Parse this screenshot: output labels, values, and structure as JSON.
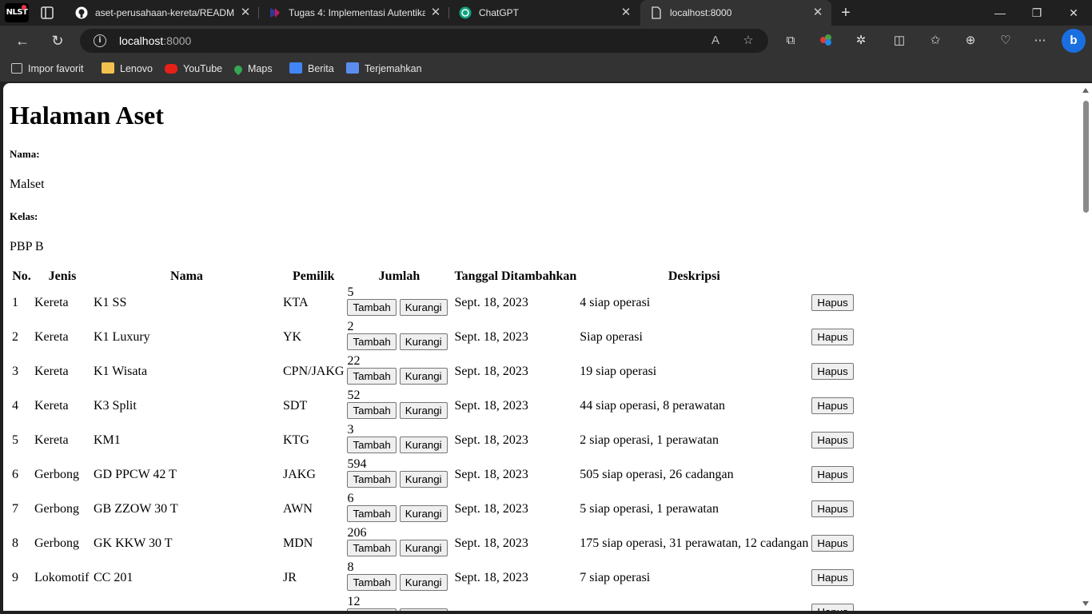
{
  "browser": {
    "profile_label": "NLST",
    "tabs": [
      {
        "title": "aset-perusahaan-kereta/READM",
        "icon": "github-icon"
      },
      {
        "title": "Tugas 4: Implementasi Autentika",
        "icon": "course-site-icon"
      },
      {
        "title": "ChatGPT",
        "icon": "chatgpt-icon"
      },
      {
        "title": "localhost:8000",
        "icon": "page-icon"
      }
    ],
    "address": {
      "host": "localhost",
      "port": ":8000"
    },
    "bookmarks": [
      {
        "label": "Impor favorit",
        "icon": "import-icon"
      },
      {
        "label": "Lenovo",
        "icon": "folder-icon"
      },
      {
        "label": "YouTube",
        "icon": "youtube-icon"
      },
      {
        "label": "Maps",
        "icon": "maps-pin-icon"
      },
      {
        "label": "Berita",
        "icon": "news-icon"
      },
      {
        "label": "Terjemahkan",
        "icon": "translate-icon"
      }
    ],
    "colors": {
      "chrome_bg": "#202020",
      "toolbar_bg": "#333333",
      "accent": "#1a6fe0"
    }
  },
  "page": {
    "title": "Halaman Aset",
    "name_label": "Nama:",
    "name_value": "Malset",
    "class_label": "Kelas:",
    "class_value": "PBP B",
    "table": {
      "headers": [
        "No.",
        "Jenis",
        "Nama",
        "Pemilik",
        "Jumlah",
        "Tanggal Ditambahkan",
        "Deskripsi"
      ],
      "add_label": "Tambah",
      "sub_label": "Kurangi",
      "delete_label": "Hapus",
      "rows": [
        {
          "no": "1",
          "jenis": "Kereta",
          "nama": "K1 SS",
          "pemilik": "KTA",
          "jumlah": "5",
          "tanggal": "Sept. 18, 2023",
          "deskripsi": "4 siap operasi"
        },
        {
          "no": "2",
          "jenis": "Kereta",
          "nama": "K1 Luxury",
          "pemilik": "YK",
          "jumlah": "2",
          "tanggal": "Sept. 18, 2023",
          "deskripsi": "Siap operasi"
        },
        {
          "no": "3",
          "jenis": "Kereta",
          "nama": "K1 Wisata",
          "pemilik": "CPN/JAKG",
          "jumlah": "22",
          "tanggal": "Sept. 18, 2023",
          "deskripsi": "19 siap operasi"
        },
        {
          "no": "4",
          "jenis": "Kereta",
          "nama": "K3 Split",
          "pemilik": "SDT",
          "jumlah": "52",
          "tanggal": "Sept. 18, 2023",
          "deskripsi": "44 siap operasi, 8 perawatan"
        },
        {
          "no": "5",
          "jenis": "Kereta",
          "nama": "KM1",
          "pemilik": "KTG",
          "jumlah": "3",
          "tanggal": "Sept. 18, 2023",
          "deskripsi": "2 siap operasi, 1 perawatan"
        },
        {
          "no": "6",
          "jenis": "Gerbong",
          "nama": "GD PPCW 42 T",
          "pemilik": "JAKG",
          "jumlah": "594",
          "tanggal": "Sept. 18, 2023",
          "deskripsi": "505 siap operasi, 26 cadangan"
        },
        {
          "no": "7",
          "jenis": "Gerbong",
          "nama": "GB ZZOW 30 T",
          "pemilik": "AWN",
          "jumlah": "6",
          "tanggal": "Sept. 18, 2023",
          "deskripsi": "5 siap operasi, 1 perawatan"
        },
        {
          "no": "8",
          "jenis": "Gerbong",
          "nama": "GK KKW 30 T",
          "pemilik": "MDN",
          "jumlah": "206",
          "tanggal": "Sept. 18, 2023",
          "deskripsi": "175 siap operasi, 31 perawatan, 12 cadangan"
        },
        {
          "no": "9",
          "jenis": "Lokomotif",
          "nama": "CC 201",
          "pemilik": "JR",
          "jumlah": "8",
          "tanggal": "Sept. 18, 2023",
          "deskripsi": "7 siap operasi"
        },
        {
          "no": "",
          "jenis": "",
          "nama": "",
          "pemilik": "",
          "jumlah": "12",
          "tanggal": "",
          "deskripsi": ""
        }
      ]
    }
  }
}
